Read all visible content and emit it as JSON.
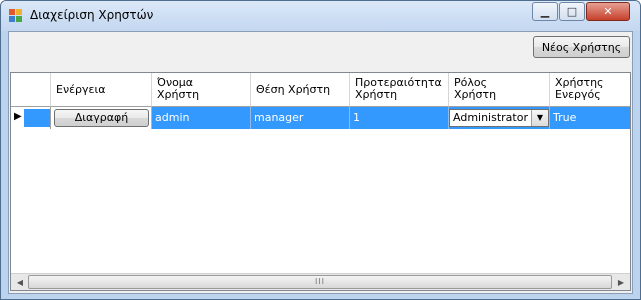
{
  "window": {
    "title": "Διαχείριση Χρηστών",
    "minimize_glyph": "▁",
    "maximize_glyph": "□",
    "close_glyph": "✕"
  },
  "toolbar": {
    "new_user_label": "Νέος Χρήστης"
  },
  "grid": {
    "columns": [
      {
        "line1": "Ενέργεια",
        "line2": ""
      },
      {
        "line1": "Όνομα",
        "line2": "Χρήστη"
      },
      {
        "line1": "Θέση Χρήστη",
        "line2": ""
      },
      {
        "line1": "Προτεραιότητα",
        "line2": "Χρήστη"
      },
      {
        "line1": "Ρόλος",
        "line2": "Χρήστη"
      },
      {
        "line1": "Χρήστης",
        "line2": "Ενεργός"
      }
    ],
    "rows": [
      {
        "action_label": "Διαγραφή",
        "username": "admin",
        "position": "manager",
        "priority": "1",
        "role": "Administrator",
        "active": "True"
      }
    ],
    "current_row_glyph": "▶",
    "combo_arrow_glyph": "▼",
    "scroll_left_glyph": "◀",
    "scroll_right_glyph": "▶",
    "scroll_grip": "III"
  },
  "colors": {
    "selection": "#3399ff",
    "titlebar": "#c3d7f0",
    "close_button": "#c6402b"
  }
}
